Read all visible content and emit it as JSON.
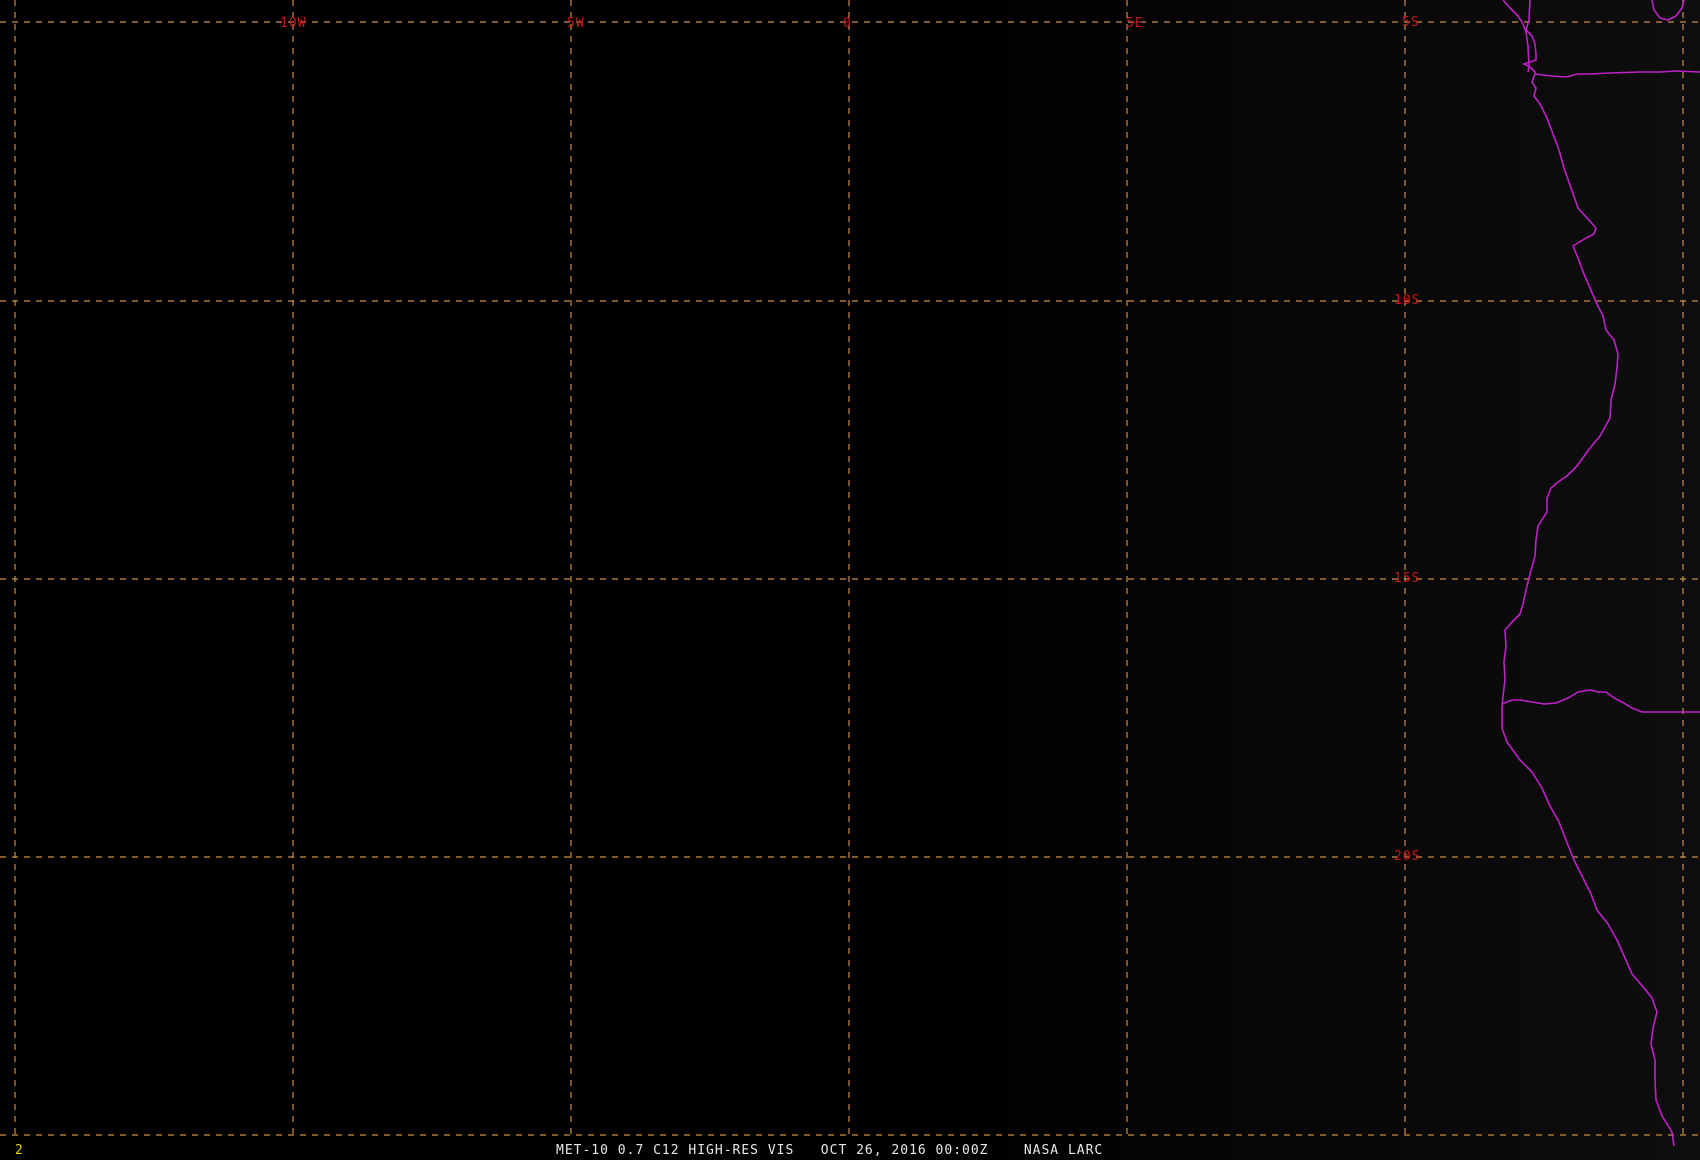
{
  "map": {
    "background": "#000000",
    "grid_color": "#c8904a",
    "label_color": "#c01818",
    "coast_color": "#c020c8",
    "longitude_labels": [
      "10W",
      "5W",
      "0",
      "5E"
    ],
    "latitude_labels": [
      "5S",
      "10S",
      "15S",
      "20S"
    ]
  },
  "caption": {
    "text": "MET-10 0.7 C12 HIGH-RES VIS   OCT 26, 2016 00:00Z    NASA LARC",
    "color": "#e8e8e8"
  },
  "frame": {
    "number": "2",
    "color": "#e6d020"
  }
}
